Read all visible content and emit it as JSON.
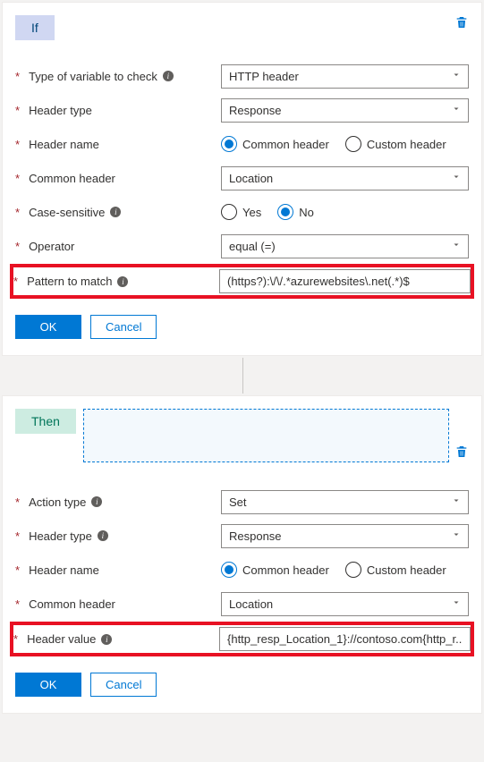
{
  "if": {
    "tag": "If",
    "fields": {
      "type_of_variable": {
        "label": "Type of variable to check",
        "value": "HTTP header"
      },
      "header_type": {
        "label": "Header type",
        "value": "Response"
      },
      "header_name": {
        "label": "Header name",
        "options": [
          "Common header",
          "Custom header"
        ],
        "selected": "Common header"
      },
      "common_header": {
        "label": "Common header",
        "value": "Location"
      },
      "case_sensitive": {
        "label": "Case-sensitive",
        "options": [
          "Yes",
          "No"
        ],
        "selected": "No"
      },
      "operator": {
        "label": "Operator",
        "value": "equal (=)"
      },
      "pattern": {
        "label": "Pattern to match",
        "value": "(https?):\\/\\/.*azurewebsites\\.net(.*)$"
      }
    },
    "ok": "OK",
    "cancel": "Cancel"
  },
  "then": {
    "tag": "Then",
    "fields": {
      "action_type": {
        "label": "Action type",
        "value": "Set"
      },
      "header_type": {
        "label": "Header type",
        "value": "Response"
      },
      "header_name": {
        "label": "Header name",
        "options": [
          "Common header",
          "Custom header"
        ],
        "selected": "Common header"
      },
      "common_header": {
        "label": "Common header",
        "value": "Location"
      },
      "header_value": {
        "label": "Header value",
        "value": "{http_resp_Location_1}://contoso.com{http_r..."
      }
    },
    "ok": "OK",
    "cancel": "Cancel"
  }
}
